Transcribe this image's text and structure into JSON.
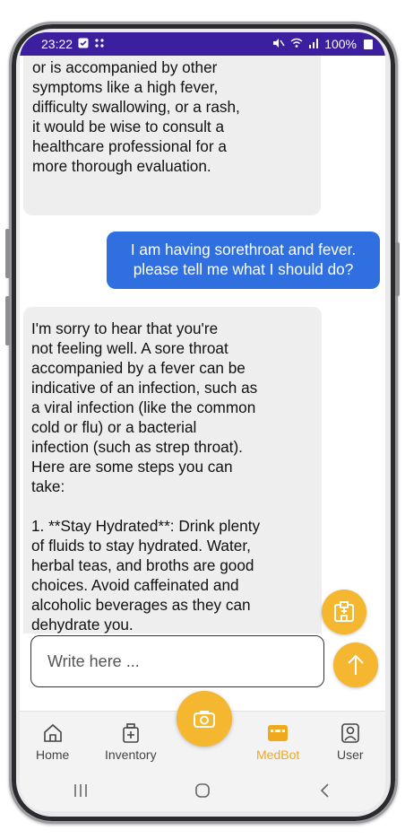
{
  "status_bar": {
    "time": "23:22",
    "left_icons": [
      "check-square-icon",
      "grid-dots-icon"
    ],
    "right_icons": [
      "mute-icon",
      "wifi-icon",
      "signal-icon"
    ],
    "battery": "100%"
  },
  "chat": {
    "messages": [
      {
        "sender": "bot",
        "text": "or is accompanied by other\nsymptoms like a high fever,\ndifficulty swallowing, or a rash,\nit would be wise to consult a\nhealthcare professional for a\nmore thorough evaluation."
      },
      {
        "sender": "user",
        "text": "I am having sorethroat and fever.\nplease tell me what I should do?"
      },
      {
        "sender": "bot",
        "text": "I'm sorry to hear that you're\nnot feeling well. A sore throat\naccompanied by a fever can be\nindicative of an infection, such as\na viral infection (like the common\ncold or flu) or a bacterial\ninfection (such as strep throat).\nHere are some steps you can\ntake:\n\n1. **Stay Hydrated**: Drink plenty\nof fluids to stay hydrated. Water,\nherbal teas, and broths are good\nchoices. Avoid caffeinated and\nalcoholic beverages as they can\ndehydrate you."
      }
    ]
  },
  "composer": {
    "placeholder": "Write here ...",
    "value": ""
  },
  "bottom_nav": {
    "items": [
      {
        "label": "Home",
        "icon": "home-icon",
        "active": false
      },
      {
        "label": "Inventory",
        "icon": "medicine-box-icon",
        "active": false
      },
      {
        "label": "MedBot",
        "icon": "chatbot-icon",
        "active": true
      },
      {
        "label": "User",
        "icon": "user-icon",
        "active": false
      }
    ]
  },
  "colors": {
    "accent": "#f5b630",
    "user_bubble": "#2f6fe0",
    "bot_bubble": "#eeeeee",
    "status_bar": "#3c1f9e",
    "active_nav": "#f0a81e"
  }
}
